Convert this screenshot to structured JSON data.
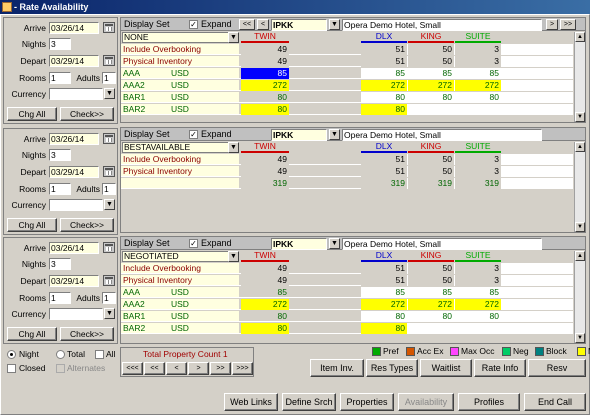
{
  "window": {
    "title": "- Rate Availability"
  },
  "left_panels": [
    {
      "arrive_label": "Arrive",
      "arrive": "03/26/14",
      "nights_label": "Nights",
      "nights": "3",
      "depart_label": "Depart",
      "depart": "03/29/14",
      "rooms_label": "Rooms",
      "rooms": "1",
      "adults_label": "Adults",
      "adults": "1",
      "currency_label": "Currency",
      "currency": "",
      "chg_all": "Chg All",
      "check": "Check>>"
    },
    {
      "arrive_label": "Arrive",
      "arrive": "03/26/14",
      "nights_label": "Nights",
      "nights": "3",
      "depart_label": "Depart",
      "depart": "03/29/14",
      "rooms_label": "Rooms",
      "rooms": "1",
      "adults_label": "Adults",
      "adults": "1",
      "currency_label": "Currency",
      "currency": "",
      "chg_all": "Chg All",
      "check": "Check>>"
    },
    {
      "arrive_label": "Arrive",
      "arrive": "03/26/14",
      "nights_label": "Nights",
      "nights": "3",
      "depart_label": "Depart",
      "depart": "03/29/14",
      "rooms_label": "Rooms",
      "rooms": "1",
      "adults_label": "Adults",
      "adults": "1",
      "currency_label": "Currency",
      "currency": "",
      "chg_all": "Chg All",
      "check": "Check>>"
    }
  ],
  "grids": [
    {
      "display_set": "Display Set",
      "expand": "Expand",
      "property": "IPKK",
      "hotel": "Opera Demo Hotel, Small",
      "rate_set": "NONE",
      "columns": [
        {
          "label": "TWIN",
          "color": "#cc0000"
        },
        {
          "label": "DLX",
          "color": "#0000cc"
        },
        {
          "label": "KING",
          "color": "#cc0000"
        },
        {
          "label": "SUITE",
          "color": "#00aa00"
        }
      ],
      "rows": [
        {
          "name": "Include Overbooking",
          "curr": "",
          "kind": "info",
          "vals": [
            "49",
            "51",
            "50",
            "3"
          ]
        },
        {
          "name": "Physical Inventory",
          "curr": "",
          "kind": "info",
          "vals": [
            "49",
            "51",
            "50",
            "3"
          ]
        },
        {
          "name": "AAA",
          "curr": "USD",
          "kind": "rate",
          "vals": [
            "85",
            "85",
            "85",
            "85"
          ],
          "hl": [
            "sel",
            "",
            "",
            ""
          ]
        },
        {
          "name": "AAA2",
          "curr": "USD",
          "kind": "rate",
          "vals": [
            "272",
            "272",
            "272",
            "272"
          ],
          "hl": [
            "y",
            "y",
            "y",
            "y"
          ]
        },
        {
          "name": "BAR1",
          "curr": "USD",
          "kind": "rate",
          "vals": [
            "80",
            "80",
            "80",
            "80"
          ],
          "hl": [
            "",
            "",
            "",
            ""
          ]
        },
        {
          "name": "BAR2",
          "curr": "USD",
          "kind": "rate",
          "vals": [
            "80",
            "80",
            "",
            ""
          ],
          "hl": [
            "y",
            "y",
            "",
            ""
          ]
        }
      ]
    },
    {
      "display_set": "Display Set",
      "expand": "Expand",
      "property": "IPKK",
      "hotel": "Opera Demo Hotel, Small",
      "rate_set": "BESTAVAILABLE",
      "columns": [
        {
          "label": "TWIN",
          "color": "#cc0000"
        },
        {
          "label": "DLX",
          "color": "#0000cc"
        },
        {
          "label": "KING",
          "color": "#cc0000"
        },
        {
          "label": "SUITE",
          "color": "#00aa00"
        }
      ],
      "rows": [
        {
          "name": "Include Overbooking",
          "curr": "",
          "kind": "info",
          "vals": [
            "49",
            "51",
            "50",
            "3"
          ]
        },
        {
          "name": "Physical Inventory",
          "curr": "",
          "kind": "info",
          "vals": [
            "49",
            "51",
            "50",
            "3"
          ]
        },
        {
          "name": "",
          "curr": "",
          "kind": "rate",
          "vals": [
            "319",
            "319",
            "319",
            "319"
          ],
          "hl": [
            "",
            "",
            "",
            ""
          ]
        }
      ]
    },
    {
      "display_set": "Display Set",
      "expand": "Expand",
      "property": "IPKK",
      "hotel": "Opera Demo Hotel, Small",
      "rate_set": "NEGOTIATED",
      "columns": [
        {
          "label": "TWIN",
          "color": "#cc0000"
        },
        {
          "label": "DLX",
          "color": "#0000cc"
        },
        {
          "label": "KING",
          "color": "#cc0000"
        },
        {
          "label": "SUITE",
          "color": "#00aa00"
        }
      ],
      "rows": [
        {
          "name": "Include Overbooking",
          "curr": "",
          "kind": "info",
          "vals": [
            "49",
            "51",
            "50",
            "3"
          ]
        },
        {
          "name": "Physical Inventory",
          "curr": "",
          "kind": "info",
          "vals": [
            "49",
            "51",
            "50",
            "3"
          ]
        },
        {
          "name": "AAA",
          "curr": "USD",
          "kind": "rate",
          "vals": [
            "85",
            "85",
            "85",
            "85"
          ],
          "hl": [
            "",
            "",
            "",
            ""
          ]
        },
        {
          "name": "AAA2",
          "curr": "USD",
          "kind": "rate",
          "vals": [
            "272",
            "272",
            "272",
            "272"
          ],
          "hl": [
            "y",
            "y",
            "y",
            "y"
          ]
        },
        {
          "name": "BAR1",
          "curr": "USD",
          "kind": "rate",
          "vals": [
            "80",
            "80",
            "80",
            "80"
          ],
          "hl": [
            "",
            "",
            "",
            ""
          ]
        },
        {
          "name": "BAR2",
          "curr": "USD",
          "kind": "rate",
          "vals": [
            "80",
            "80",
            "",
            ""
          ],
          "hl": [
            "y",
            "y",
            "",
            ""
          ]
        }
      ]
    }
  ],
  "options": {
    "night": "Night",
    "total": "Total",
    "all": "All",
    "closed": "Closed",
    "alternates": "Alternates"
  },
  "total_count": "Total Property Count 1",
  "nav": [
    "<<<",
    "<<",
    "<",
    ">",
    ">>",
    ">>>"
  ],
  "legend": [
    {
      "label": "Pref",
      "color": "#00aa00"
    },
    {
      "label": "Acc Ex",
      "color": "#d45500"
    },
    {
      "label": "Max Occ",
      "color": "#ff44ff"
    },
    {
      "label": "Neg",
      "color": "#00cc66"
    },
    {
      "label": "Block",
      "color": "#008080"
    },
    {
      "label": "MR",
      "color": "#ffff00"
    }
  ],
  "actions_row1": [
    "Item Inv.",
    "Res Types",
    "Waitlist",
    "Rate Info",
    "Resv"
  ],
  "actions_row2": [
    "Web Links",
    "Define Srch",
    "Properties",
    "Availability",
    "Profiles",
    "End Call"
  ]
}
